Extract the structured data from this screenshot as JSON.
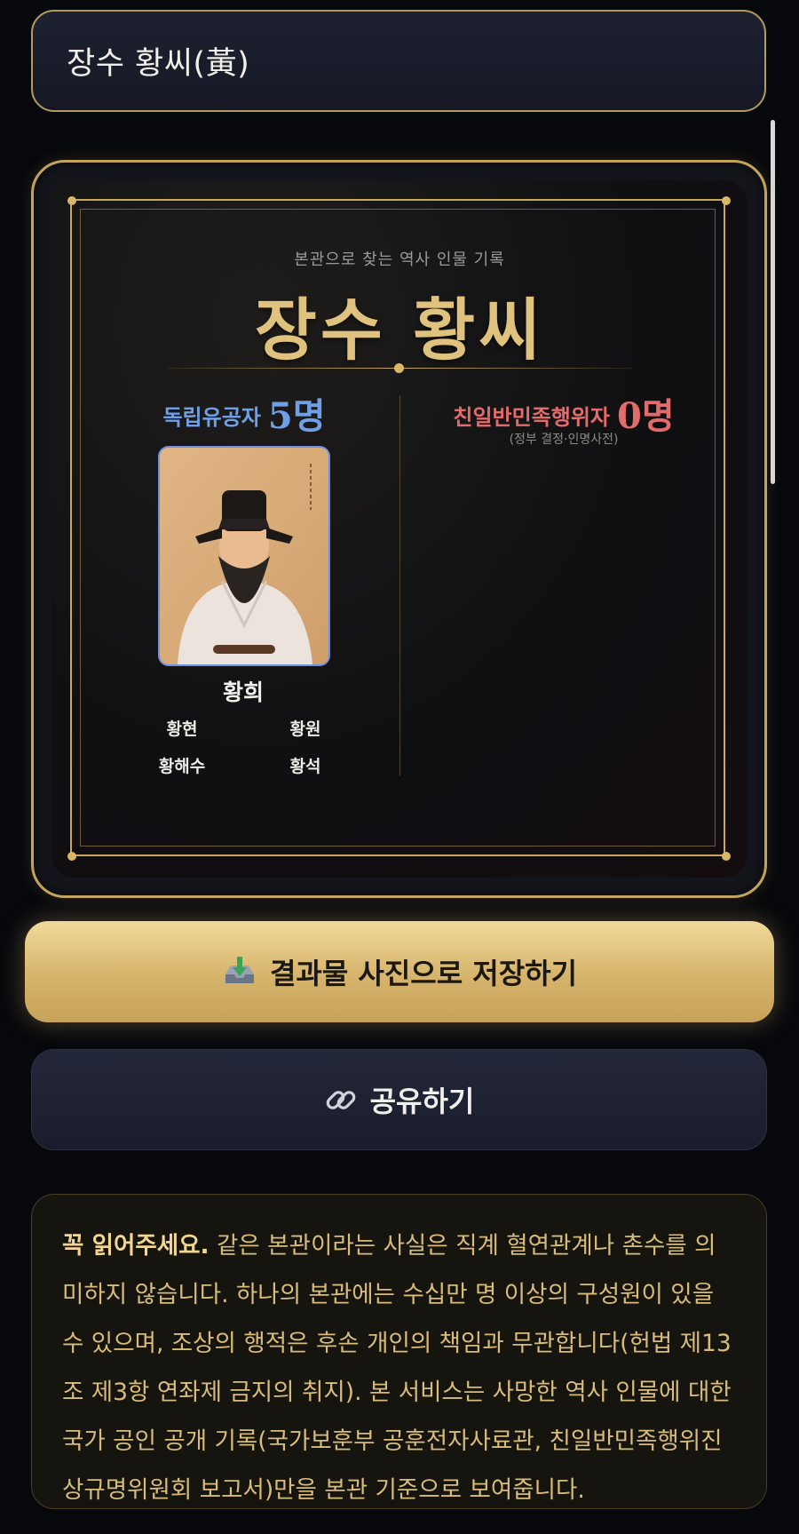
{
  "search": {
    "value": "장수 황씨(黃)"
  },
  "card": {
    "eyebrow": "본관으로 찾는 역사 인물 기록",
    "title": "장수 황씨",
    "independence": {
      "label": "독립유공자",
      "count": "5명"
    },
    "collaborator": {
      "label": "친일반민족행위자",
      "count": "0명",
      "note": "(정부 결정·인명사전)"
    },
    "featured": {
      "name": "황희"
    },
    "descendants": [
      "황현",
      "황원",
      "황해수",
      "황석"
    ]
  },
  "actions": {
    "save_label": "결과물 사진으로 저장하기",
    "save_icon": "download-tray-icon",
    "share_label": "공유하기",
    "share_icon": "link-icon"
  },
  "notice": {
    "strong": "꼭 읽어주세요.",
    "body": " 같은 본관이라는 사실은 직계 혈연관계나 촌수를 의미하지 않습니다. 하나의 본관에는 수십만 명 이상의 구성원이 있을 수 있으며, 조상의 행적은 후손 개인의 책임과 무관합니다(헌법 제13조 제3항 연좌제 금지의 취지). 본 서비스는 사망한 역사 인물에 대한 국가 공인 공개 기록(국가보훈부 공훈전자사료관, 친일반민족행위진상규명위원회 보고서)만을 본관 기준으로 보여줍니다."
  },
  "colors": {
    "gold": "#c9a85e",
    "independence_blue": "#6fa0e6",
    "collaborator_red": "#e26b6b",
    "background": "#07080c"
  }
}
